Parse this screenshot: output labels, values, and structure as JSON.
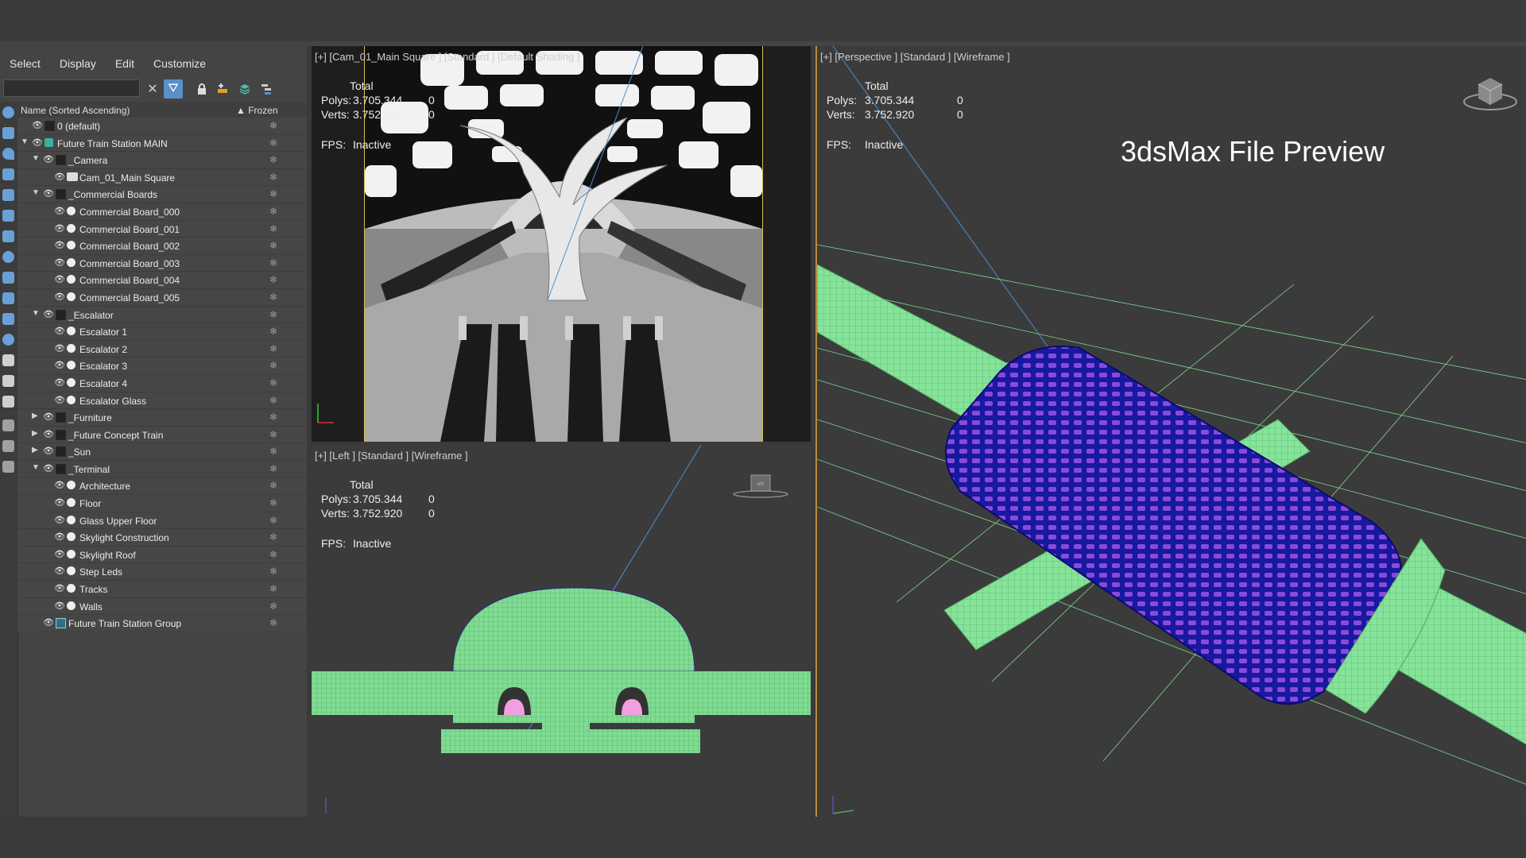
{
  "menu": [
    "Select",
    "Display",
    "Edit",
    "Customize"
  ],
  "explorer": {
    "column_name": "Name (Sorted Ascending)",
    "column_frozen": "Frozen",
    "rows": [
      {
        "label": "0 (default)",
        "depth": 0,
        "arrow": "",
        "icon": "layer-icon"
      },
      {
        "label": "Future Train Station MAIN",
        "depth": 0,
        "arrow": "expanded",
        "icon": "layer-stack-icon"
      },
      {
        "label": "_Camera",
        "depth": 1,
        "arrow": "expanded",
        "icon": "layer-icon"
      },
      {
        "label": "Cam_01_Main Square",
        "depth": 2,
        "arrow": "",
        "icon": "camera-icon"
      },
      {
        "label": "_Commercial Boards",
        "depth": 1,
        "arrow": "expanded",
        "icon": "layer-icon"
      },
      {
        "label": "Commercial Board_000",
        "depth": 2,
        "arrow": "",
        "icon": "object-icon"
      },
      {
        "label": "Commercial Board_001",
        "depth": 2,
        "arrow": "",
        "icon": "object-icon"
      },
      {
        "label": "Commercial Board_002",
        "depth": 2,
        "arrow": "",
        "icon": "object-icon"
      },
      {
        "label": "Commercial Board_003",
        "depth": 2,
        "arrow": "",
        "icon": "object-icon"
      },
      {
        "label": "Commercial Board_004",
        "depth": 2,
        "arrow": "",
        "icon": "object-icon"
      },
      {
        "label": "Commercial Board_005",
        "depth": 2,
        "arrow": "",
        "icon": "object-icon"
      },
      {
        "label": "_Escalator",
        "depth": 1,
        "arrow": "expanded",
        "icon": "layer-icon"
      },
      {
        "label": "Escalator 1",
        "depth": 2,
        "arrow": "",
        "icon": "object-icon"
      },
      {
        "label": "Escalator 2",
        "depth": 2,
        "arrow": "",
        "icon": "object-icon"
      },
      {
        "label": "Escalator 3",
        "depth": 2,
        "arrow": "",
        "icon": "object-icon"
      },
      {
        "label": "Escalator 4",
        "depth": 2,
        "arrow": "",
        "icon": "object-icon"
      },
      {
        "label": "Escalator Glass",
        "depth": 2,
        "arrow": "",
        "icon": "object-icon"
      },
      {
        "label": "_Furniture",
        "depth": 1,
        "arrow": "collapsed",
        "icon": "layer-icon"
      },
      {
        "label": "_Future Concept Train",
        "depth": 1,
        "arrow": "collapsed",
        "icon": "layer-icon"
      },
      {
        "label": "_Sun",
        "depth": 1,
        "arrow": "collapsed",
        "icon": "layer-icon"
      },
      {
        "label": "_Terminal",
        "depth": 1,
        "arrow": "expanded",
        "icon": "layer-icon"
      },
      {
        "label": "Architecture",
        "depth": 2,
        "arrow": "",
        "icon": "object-icon"
      },
      {
        "label": "Floor",
        "depth": 2,
        "arrow": "",
        "icon": "object-icon"
      },
      {
        "label": "Glass Upper Floor",
        "depth": 2,
        "arrow": "",
        "icon": "object-icon"
      },
      {
        "label": "Skylight Construction",
        "depth": 2,
        "arrow": "",
        "icon": "object-icon"
      },
      {
        "label": "Skylight Roof",
        "depth": 2,
        "arrow": "",
        "icon": "object-icon"
      },
      {
        "label": "Step Leds",
        "depth": 2,
        "arrow": "",
        "icon": "object-icon"
      },
      {
        "label": "Tracks",
        "depth": 2,
        "arrow": "",
        "icon": "object-icon"
      },
      {
        "label": "Walls",
        "depth": 2,
        "arrow": "",
        "icon": "object-icon"
      },
      {
        "label": "Future Train Station Group",
        "depth": 1,
        "arrow": "",
        "icon": "group-icon"
      }
    ]
  },
  "viewports": {
    "camera": {
      "label": "[+] [Cam_01_Main Square ] [Standard ] [Default Shading ]",
      "total": "Total",
      "polys_label": "Polys:",
      "polys": "3.705.344",
      "polys_sel": "0",
      "verts_label": "Verts:",
      "verts": "3.752.920",
      "verts_sel": "0",
      "fps_label": "FPS:",
      "fps": "Inactive"
    },
    "left": {
      "label": "[+] [Left ] [Standard ] [Wireframe ]",
      "total": "Total",
      "polys_label": "Polys:",
      "polys": "3.705.344",
      "polys_sel": "0",
      "verts_label": "Verts:",
      "verts": "3.752.920",
      "verts_sel": "0",
      "fps_label": "FPS:",
      "fps": "Inactive",
      "cube_label": "left"
    },
    "perspective": {
      "label": "[+] [Perspective ] [Standard ] [Wireframe ]",
      "total": "Total",
      "polys_label": "Polys:",
      "polys": "3.705.344",
      "polys_sel": "0",
      "verts_label": "Verts:",
      "verts": "3.752.920",
      "verts_sel": "0",
      "fps_label": "FPS:",
      "fps": "Inactive",
      "title": "3dsMax File Preview"
    }
  },
  "colors": {
    "wire_green": "#8ee8a0",
    "wire_blue": "#1a1aa8",
    "glass_purple": "#a060e0",
    "active_border": "#b88a3a",
    "filter_active": "#5b8fc9"
  }
}
